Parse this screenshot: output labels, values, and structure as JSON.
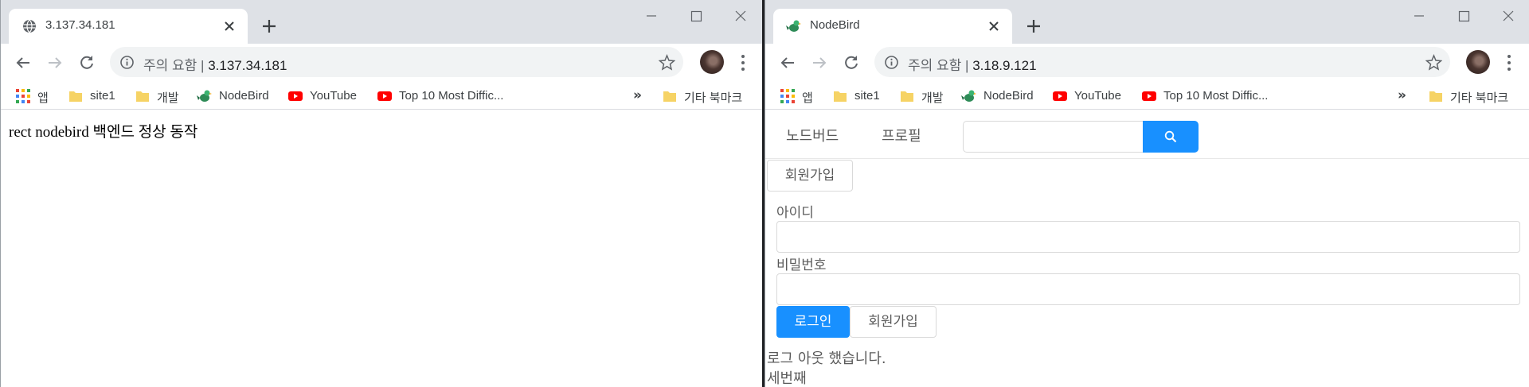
{
  "left_window": {
    "tab": {
      "title": "3.137.34.181",
      "favicon": "globe-icon"
    },
    "address": {
      "security_label": "주의 요함",
      "separator": "|",
      "url": "3.137.34.181"
    },
    "page_text": "rect nodebird 백엔드 정상 동작"
  },
  "right_window": {
    "tab": {
      "title": "NodeBird",
      "favicon": "nodebird-favicon"
    },
    "address": {
      "security_label": "주의 요함",
      "separator": "|",
      "url": "3.18.9.121"
    },
    "menu": {
      "home": "노드버드",
      "profile": "프로필"
    },
    "signup_top": "회원가입",
    "form": {
      "id_label": "아이디",
      "id_value": "",
      "password_label": "비밀번호",
      "password_value": "",
      "login_button": "로그인",
      "signup_button": "회원가입"
    },
    "messages": [
      "로그 아웃 했습니다.",
      "세번째"
    ]
  },
  "bookmarks": {
    "apps": "앱",
    "items": [
      "site1",
      "개발",
      "NodeBird",
      "YouTube",
      "Top 10 Most Diffic..."
    ],
    "more": "»",
    "other": "기타 북마크"
  },
  "colors": {
    "primary": "#1890ff",
    "tabstrip": "#dee1e6",
    "omnibox": "#f1f3f4"
  }
}
